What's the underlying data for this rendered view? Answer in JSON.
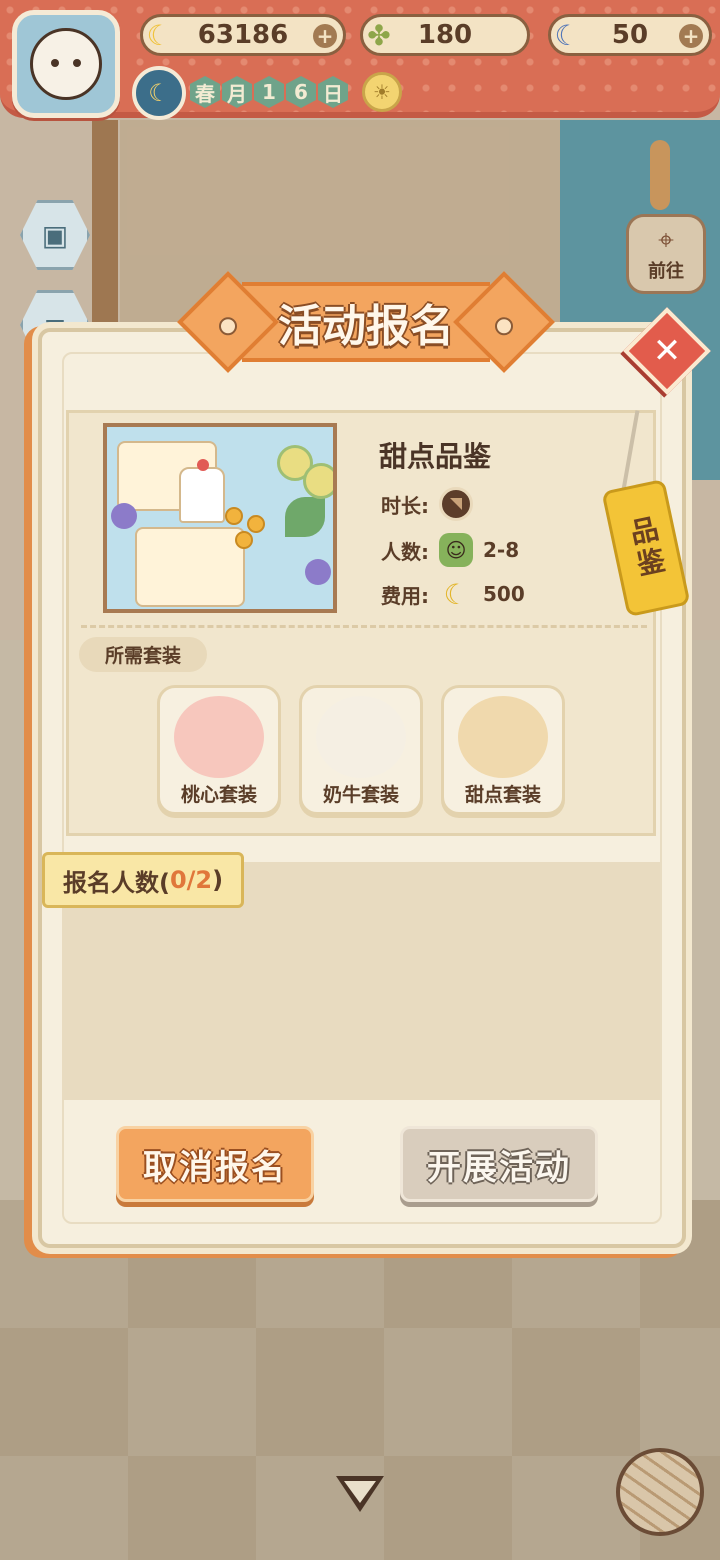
{
  "hud": {
    "bananas": "63186",
    "clovers": "180",
    "gems": "50",
    "date": [
      "春",
      "月",
      "1",
      "6",
      "日"
    ],
    "goto_label": "前往"
  },
  "modal": {
    "title": "活动报名",
    "activity": {
      "name": "甜点品鉴",
      "duration_label": "时长:",
      "people_label": "人数:",
      "people_value": "2-8",
      "cost_label": "费用:",
      "cost_value": "500",
      "tag": "品鉴"
    },
    "required_suits_label": "所需套装",
    "suits": [
      {
        "name": "桃心套装",
        "icon": "peach-heart-outfit-icon"
      },
      {
        "name": "奶牛套装",
        "icon": "cow-outfit-icon"
      },
      {
        "name": "甜点套装",
        "icon": "dessert-outfit-icon"
      }
    ],
    "signup": {
      "label": "报名人数(",
      "count": "0/2",
      "close": ")"
    },
    "cancel_button": "取消报名",
    "start_button": "开展活动"
  },
  "colors": {
    "accent_orange": "#f3a55f",
    "curtain_red": "#d96e55",
    "close_red": "#e25c4c",
    "tag_yellow": "#f3c437"
  }
}
